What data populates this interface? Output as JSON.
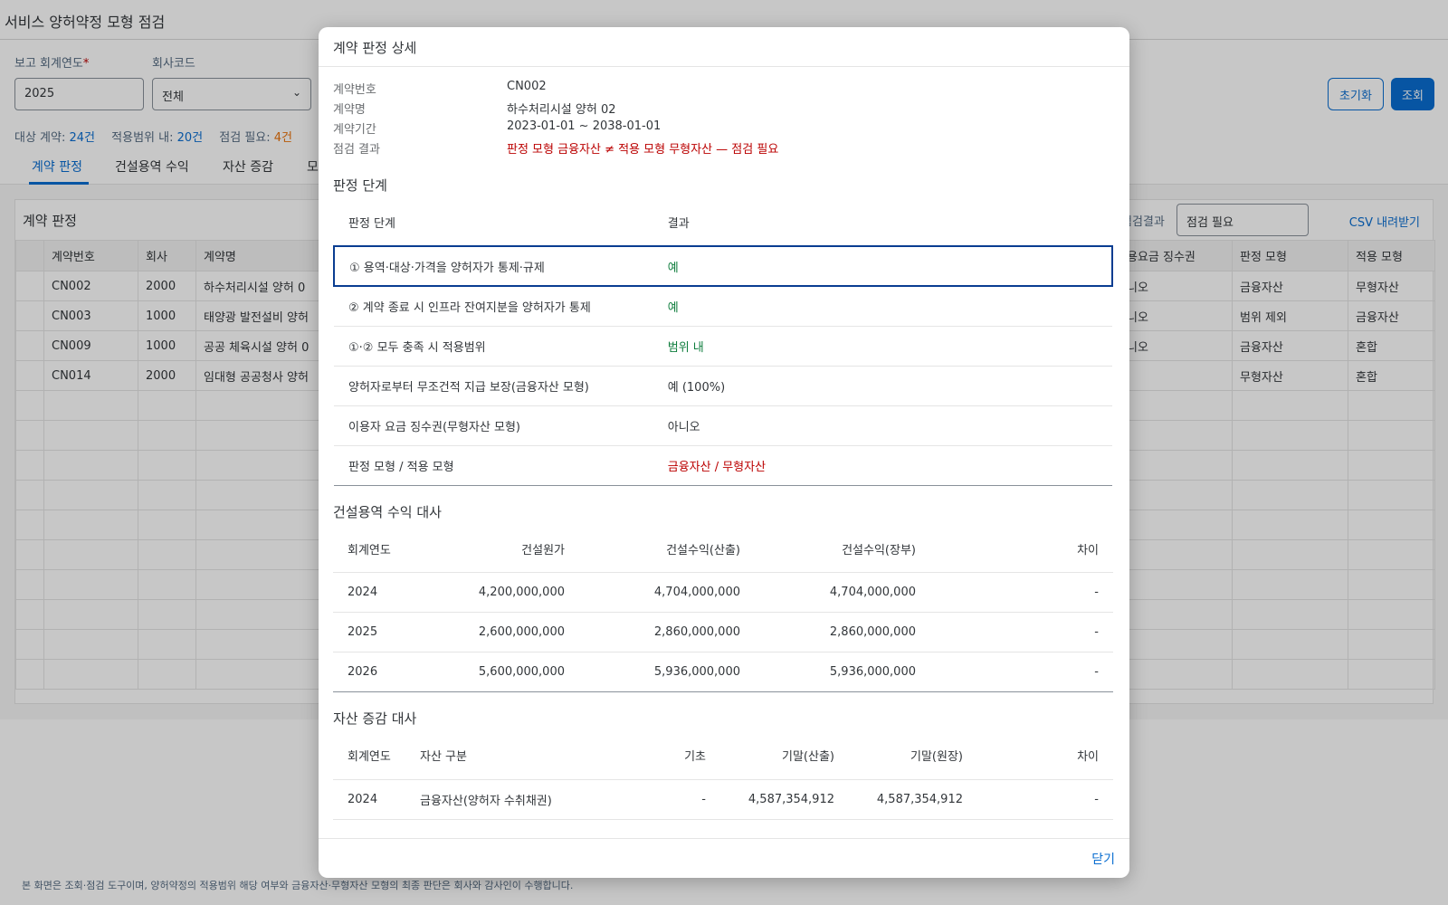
{
  "app": {
    "title": "서비스 양허약정 모형 점검"
  },
  "filters": {
    "year_label": "보고 회계연도",
    "year_required": "*",
    "year_value": "2025",
    "company_label": "회사코드",
    "company_value": "전체",
    "reset_label": "초기화",
    "search_label": "조회"
  },
  "summary": {
    "target_label": "대상 계약: ",
    "target_value": "24건",
    "scope_label": "적용범위 내: ",
    "scope_value": "20건",
    "check_label": "점검 필요: ",
    "check_value": "4건"
  },
  "tabs": [
    {
      "label": "계약 판정"
    },
    {
      "label": "건설용역 수익"
    },
    {
      "label": "자산 증감"
    },
    {
      "label": "모"
    }
  ],
  "panel": {
    "title": "계약 판정",
    "filter_label": "점검결과",
    "filter_value": "점검 필요",
    "csv_label": "CSV 내려받기",
    "columns": [
      "계약번호",
      "회사",
      "계약명",
      "용요금 징수권",
      "판정 모형",
      "적용 모형"
    ],
    "rows": [
      {
        "id": "CN002",
        "company": "2000",
        "name": "하수처리시설 양허 0",
        "fee": "니오",
        "judged": "금융자산",
        "applied": "무형자산"
      },
      {
        "id": "CN003",
        "company": "1000",
        "name": "태양광 발전설비 양허",
        "fee": "니오",
        "judged": "범위 제외",
        "applied": "금융자산"
      },
      {
        "id": "CN009",
        "company": "1000",
        "name": "공공 체육시설 양허 0",
        "fee": "니오",
        "judged": "금융자산",
        "applied": "혼합"
      },
      {
        "id": "CN014",
        "company": "2000",
        "name": "임대형 공공청사 양허",
        "fee": "",
        "judged": "무형자산",
        "applied": "혼합"
      }
    ]
  },
  "footer_note": "본 화면은 조회·점검 도구이며, 양허약정의 적용범위 해당 여부와 금융자산·무형자산 모형의 최종 판단은 회사와 감사인이 수행합니다.",
  "modal": {
    "title": "계약 판정 상세",
    "info": {
      "contract_no_label": "계약번호",
      "contract_no": "CN002",
      "contract_name_label": "계약명",
      "contract_name": "하수처리시설 양허 02",
      "period_label": "계약기간",
      "period": "2023-01-01 ~ 2038-01-01",
      "result_label": "점검 결과",
      "result": "판정 모형 금융자산 ≠ 적용 모형 무형자산 — 점검 필요"
    },
    "steps": {
      "title": "판정 단계",
      "col_step": "판정 단계",
      "col_result": "결과",
      "rows": [
        {
          "step": "① 용역·대상·가격을 양허자가 통제·규제",
          "result": "예"
        },
        {
          "step": "② 계약 종료 시 인프라 잔여지분을 양허자가 통제",
          "result": "예"
        },
        {
          "step": "①·② 모두 충족 시 적용범위",
          "result": "범위 내"
        },
        {
          "step": "양허자로부터 무조건적 지급 보장(금융자산 모형)",
          "result": "예 (100%)"
        },
        {
          "step": "이용자 요금 징수권(무형자산 모형)",
          "result": "아니오"
        },
        {
          "step": "판정 모형 / 적용 모형",
          "result": "금융자산 / 무형자산"
        }
      ]
    },
    "construction": {
      "title": "건설용역 수익 대사",
      "columns": [
        "회계연도",
        "건설원가",
        "건설수익(산출)",
        "건설수익(장부)",
        "차이"
      ],
      "rows": [
        [
          "2024",
          "4,200,000,000",
          "4,704,000,000",
          "4,704,000,000",
          "-"
        ],
        [
          "2025",
          "2,600,000,000",
          "2,860,000,000",
          "2,860,000,000",
          "-"
        ],
        [
          "2026",
          "5,600,000,000",
          "5,936,000,000",
          "5,936,000,000",
          "-"
        ]
      ]
    },
    "assets": {
      "title": "자산 증감 대사",
      "columns": [
        "회계연도",
        "자산 구분",
        "기초",
        "기말(산출)",
        "기말(원장)",
        "차이"
      ],
      "rows": [
        [
          "2024",
          "금융자산(양허자 수취채권)",
          "-",
          "4,587,354,912",
          "4,587,354,912",
          "-"
        ]
      ]
    },
    "close_label": "닫기"
  }
}
